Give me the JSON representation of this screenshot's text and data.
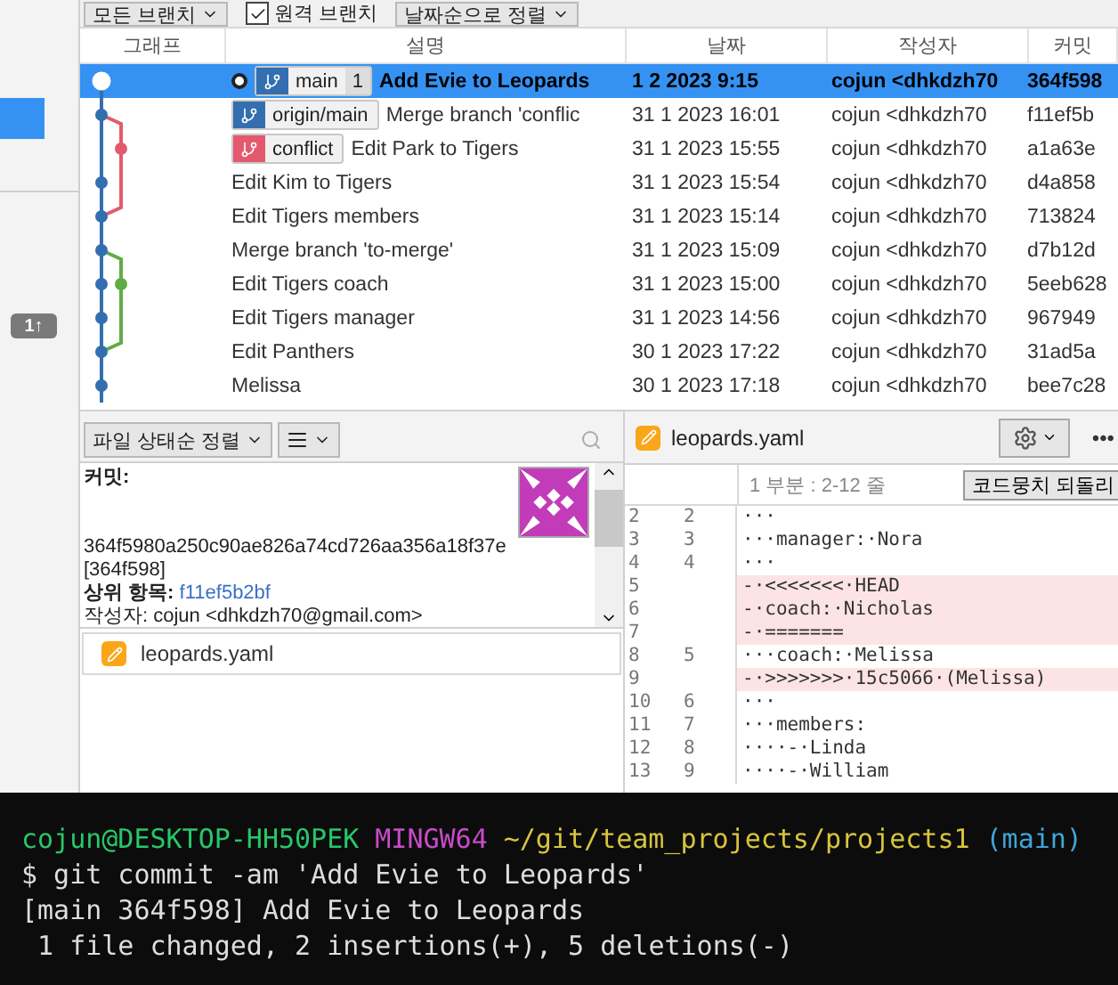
{
  "toolbar": {
    "branches": "모든 브랜치",
    "remote": {
      "label": "원격 브랜치",
      "checked": true
    },
    "sort": "날짜순으로 정렬"
  },
  "sidebar": {
    "badge": "1↑"
  },
  "table": {
    "columns": [
      "그래프",
      "설명",
      "날짜",
      "작성자",
      "커밋"
    ],
    "rows": [
      {
        "selected": true,
        "head": true,
        "tags": [
          {
            "kind": "local",
            "label": "main",
            "count": "1"
          }
        ],
        "description": "Add Evie to Leopards",
        "date": "1 2 2023 9:15",
        "author": "cojun <dhkdzh70",
        "commit": "364f598"
      },
      {
        "selected": false,
        "head": false,
        "tags": [
          {
            "kind": "remote",
            "label": "origin/main"
          }
        ],
        "description": "Merge branch 'conflic",
        "date": "31 1 2023 16:01",
        "author": "cojun <dhkdzh70",
        "commit": "f11ef5b"
      },
      {
        "selected": false,
        "head": false,
        "tags": [
          {
            "kind": "conflict",
            "label": "conflict"
          }
        ],
        "description": "Edit Park to Tigers",
        "date": "31 1 2023 15:55",
        "author": "cojun <dhkdzh70",
        "commit": "a1a63e"
      },
      {
        "selected": false,
        "head": false,
        "tags": [],
        "description": "Edit Kim to Tigers",
        "date": "31 1 2023 15:54",
        "author": "cojun <dhkdzh70",
        "commit": "d4a858"
      },
      {
        "selected": false,
        "head": false,
        "tags": [],
        "description": "Edit Tigers members",
        "date": "31 1 2023 15:14",
        "author": "cojun <dhkdzh70",
        "commit": "713824"
      },
      {
        "selected": false,
        "head": false,
        "tags": [],
        "description": "Merge branch 'to-merge'",
        "date": "31 1 2023 15:09",
        "author": "cojun <dhkdzh70",
        "commit": "d7b12d"
      },
      {
        "selected": false,
        "head": false,
        "tags": [],
        "description": "Edit Tigers coach",
        "date": "31 1 2023 15:00",
        "author": "cojun <dhkdzh70",
        "commit": "5eeb628"
      },
      {
        "selected": false,
        "head": false,
        "tags": [],
        "description": "Edit Tigers manager",
        "date": "31 1 2023 14:56",
        "author": "cojun <dhkdzh70",
        "commit": "967949"
      },
      {
        "selected": false,
        "head": false,
        "tags": [],
        "description": "Edit Panthers",
        "date": "30 1 2023 17:22",
        "author": "cojun <dhkdzh70",
        "commit": "31ad5a"
      },
      {
        "selected": false,
        "head": false,
        "tags": [],
        "description": "Melissa",
        "date": "30 1 2023 17:18",
        "author": "cojun <dhkdzh70",
        "commit": "bee7c28"
      }
    ]
  },
  "files_panel": {
    "sort": "파일 상태순 정렬",
    "details": {
      "commit_label": "커밋:",
      "hash": "364f5980a250c90ae826a74cd726aa356a18f37e",
      "short": "[364f598]",
      "parent_label": "상위 항목:",
      "parent": "f11ef5b2bf",
      "author": "작성자: cojun <dhkdzh70@gmail.com>"
    },
    "files": [
      "leopards.yaml"
    ]
  },
  "diff": {
    "file": "leopards.yaml",
    "more": "•••",
    "hunk": "1 부분 : 2-12 줄",
    "revert": "코드뭉치 되돌리",
    "lines": [
      {
        "kind": "context",
        "old": "2",
        "new": "2",
        "text": "···"
      },
      {
        "kind": "context",
        "old": "3",
        "new": "3",
        "text": "···manager:·Nora"
      },
      {
        "kind": "context",
        "old": "4",
        "new": "4",
        "text": "···"
      },
      {
        "kind": "removed",
        "old": "5",
        "text": "-·<<<<<<<·HEAD"
      },
      {
        "kind": "removed",
        "old": "6",
        "text": "-·coach:·Nicholas"
      },
      {
        "kind": "removed",
        "old": "7",
        "text": "-·======="
      },
      {
        "kind": "context",
        "old": "8",
        "new": "5",
        "text": "···coach:·Melissa"
      },
      {
        "kind": "removed",
        "old": "9",
        "text": "-·>>>>>>>·15c5066·(Melissa)"
      },
      {
        "kind": "context",
        "old": "10",
        "new": "6",
        "text": "···"
      },
      {
        "kind": "context",
        "old": "11",
        "new": "7",
        "text": "···members:"
      },
      {
        "kind": "context",
        "old": "12",
        "new": "8",
        "text": "····-·Linda"
      },
      {
        "kind": "context",
        "old": "13",
        "new": "9",
        "text": "····-·William"
      }
    ]
  },
  "terminal": {
    "prompt": [
      {
        "kind": "user",
        "text": "cojun@DESKTOP-HH50PEK"
      },
      {
        "kind": "system",
        "text": "MINGW64"
      },
      {
        "kind": "path",
        "text": "~/git/team_projects/projects1"
      },
      {
        "kind": "branch",
        "text": "(main)"
      }
    ],
    "lines": [
      "$ git commit -am 'Add Evie to Leopards'",
      "[main 364f598] Add Evie to Leopards",
      " 1 file changed, 2 insertions(+), 5 deletions(-)"
    ]
  }
}
